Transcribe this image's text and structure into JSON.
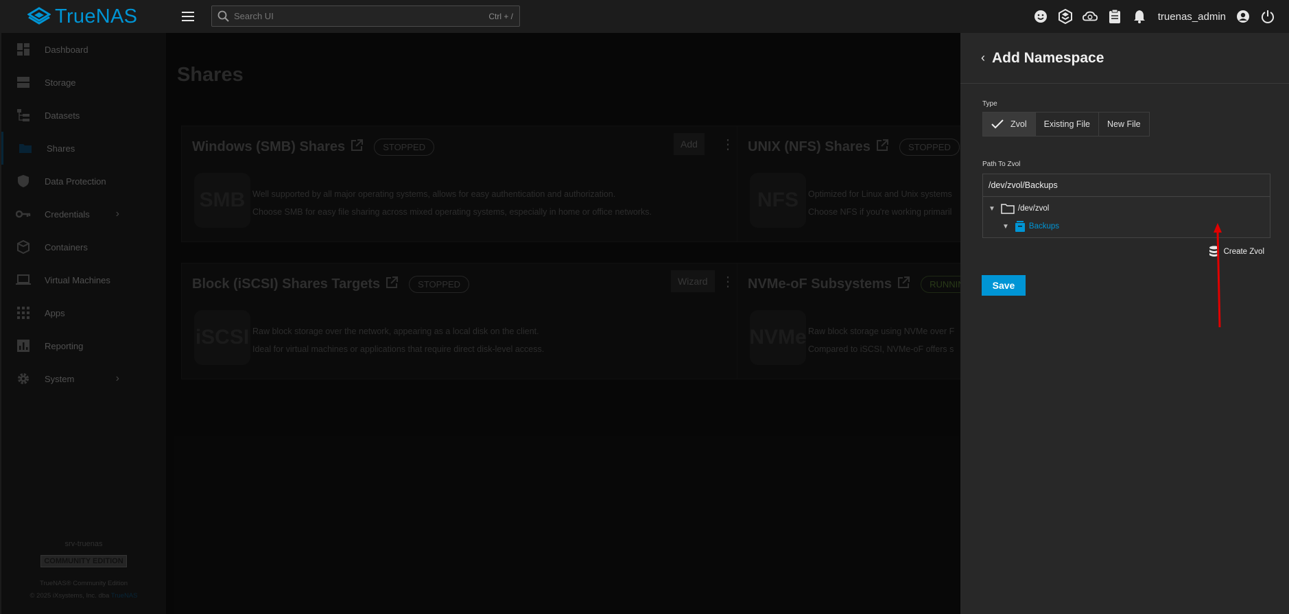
{
  "app": {
    "logo_text": "TrueNAS",
    "username": "truenas_admin"
  },
  "search": {
    "placeholder": "Search UI",
    "shortcut": "Ctrl + /"
  },
  "top_icons": [
    "smiley-icon",
    "truecommand-icon",
    "cloud-jobs-icon",
    "clipboard-icon",
    "bell-icon",
    "account-icon",
    "power-icon"
  ],
  "sidebar": {
    "items": [
      {
        "label": "Dashboard",
        "icon": "dashboard-icon"
      },
      {
        "label": "Storage",
        "icon": "storage-icon"
      },
      {
        "label": "Datasets",
        "icon": "datasets-icon"
      },
      {
        "label": "Shares",
        "icon": "shares-icon"
      },
      {
        "label": "Data Protection",
        "icon": "shield-icon"
      },
      {
        "label": "Credentials",
        "icon": "key-icon"
      },
      {
        "label": "Containers",
        "icon": "cube-icon"
      },
      {
        "label": "Virtual Machines",
        "icon": "laptop-icon"
      },
      {
        "label": "Apps",
        "icon": "apps-grid-icon"
      },
      {
        "label": "Reporting",
        "icon": "chart-icon"
      },
      {
        "label": "System",
        "icon": "gear-icon"
      }
    ],
    "active": "Shares",
    "footer": {
      "hostname": "srv-truenas",
      "edition": "COMMUNITY EDITION",
      "product": "TrueNAS® Community Edition",
      "copyright": "© 2025 iXsystems, Inc. dba",
      "link": "TrueNAS"
    }
  },
  "main": {
    "title": "Shares",
    "cards": [
      {
        "title": "Windows (SMB) Shares",
        "status": "STOPPED",
        "button": "Add",
        "icon_text": "SMB",
        "desc1": "Well supported by all major operating systems, allows for easy authentication and authorization.",
        "desc2": "Choose SMB for easy file sharing across mixed operating systems, especially in home or office networks."
      },
      {
        "title": "UNIX (NFS) Shares",
        "status": "STOPPED",
        "icon_text": "NFS",
        "desc1": "Optimized for Linux and Unix systems",
        "desc2": "Choose NFS if you're working primaril"
      },
      {
        "title": "Block (iSCSI) Shares Targets",
        "status": "STOPPED",
        "button": "Wizard",
        "icon_text": "iSCSI",
        "desc1": "Raw block storage over the network, appearing as a local disk on the client.",
        "desc2": "Ideal for virtual machines or applications that require direct disk-level access."
      },
      {
        "title": "NVMe-oF Subsystems",
        "status": "RUNNIN",
        "icon_text": "NVMe",
        "desc1": "Raw block storage using NVMe over F",
        "desc2": "Compared to iSCSI, NVMe-oF offers s"
      }
    ]
  },
  "panel": {
    "title": "Add Namespace",
    "type_label": "Type",
    "type_options": [
      "Zvol",
      "Existing File",
      "New File"
    ],
    "type_selected": "Zvol",
    "path_label": "Path To Zvol",
    "path_value": "/dev/zvol/Backups",
    "tree": [
      {
        "label": "/dev/zvol",
        "icon": "folder-icon"
      },
      {
        "label": "Backups",
        "icon": "dataset-icon"
      }
    ],
    "create_label": "Create Zvol",
    "save_label": "Save"
  },
  "colors": {
    "accent": "#0095d5",
    "annotation": "#e00000"
  }
}
